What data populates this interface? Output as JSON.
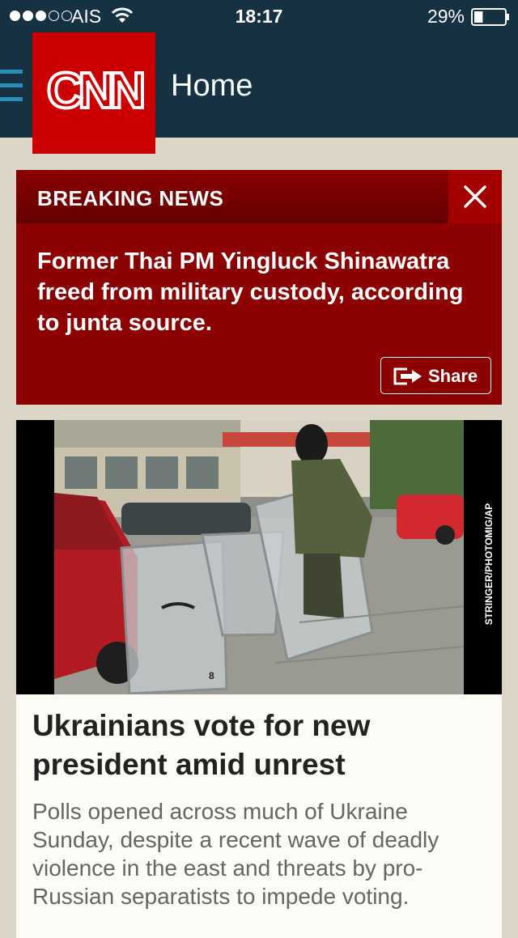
{
  "status_bar": {
    "carrier": "AIS",
    "time": "18:17",
    "battery": "29%",
    "battery_level": 0.29,
    "signal_bars_filled": 3,
    "signal_bars_total": 5
  },
  "nav": {
    "logo_text": "CNN",
    "title": "Home",
    "menu_icon": "hamburger-icon"
  },
  "breaking_news": {
    "label": "BREAKING NEWS",
    "text": "Former Thai PM Yingluck Shinawatra freed from military custody, according to junta source.",
    "share_label": "Share",
    "close_icon": "close-icon",
    "share_icon": "share-arrow-icon"
  },
  "story": {
    "photo_credit": "STRINGER/PHOTOMIG/AP",
    "headline": "Ukrainians vote for new president amid unrest",
    "summary": "Polls opened across much of Ukraine Sunday, despite a recent wave of deadly violence in the east and threats by pro-Russian separatists to impede voting."
  },
  "colors": {
    "nav_bg": "#163142",
    "cnn_red": "#cc0000",
    "breaking_bg": "#8c0101",
    "page_bg": "#dcd6c8",
    "menu_accent": "#2a8fb5"
  }
}
